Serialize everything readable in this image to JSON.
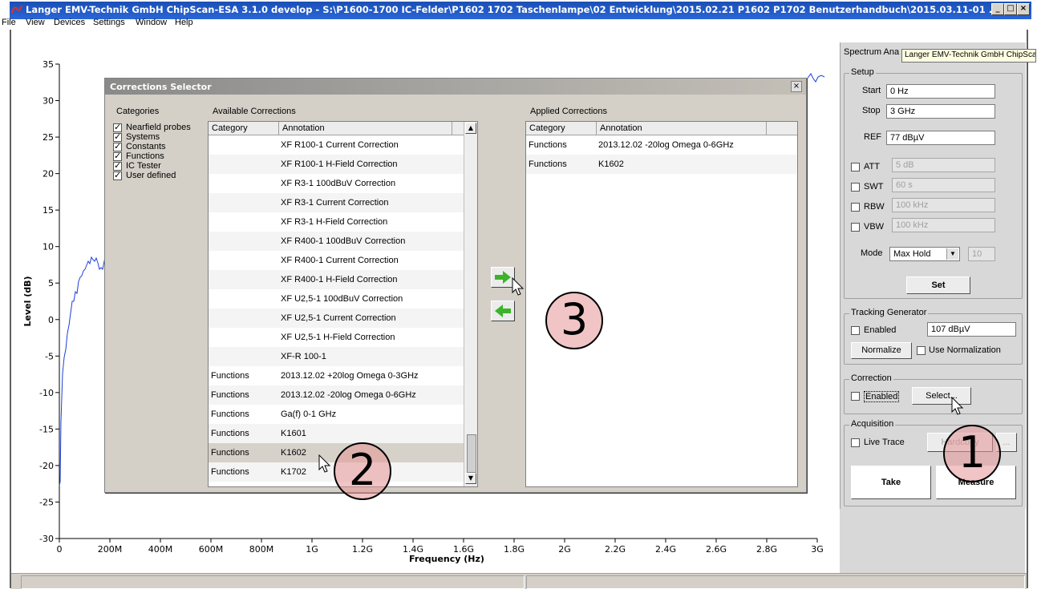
{
  "window": {
    "title": "Langer EMV-Technik GmbH ChipScan-ESA 3.1.0 develop  -  S:\\P1600-1700 IC-Felder\\P1602 1702 Taschenlampe\\02 Entwicklung\\2015.02.21 P1602 P1702 Benutzerhandbuch\\2015.03.11-01 ...",
    "minimize": "_",
    "maximize": "□",
    "close": "×"
  },
  "menu": [
    "File",
    "View",
    "Devices",
    "Settings",
    "Window",
    "Help"
  ],
  "chart": {
    "ylabel": "Level (dB)",
    "xlabel": "Frequency (Hz)",
    "y_ticks": [
      "35",
      "30",
      "25",
      "20",
      "15",
      "10",
      "5",
      "0",
      "-5",
      "-10",
      "-15",
      "-20",
      "-25",
      "-30"
    ],
    "x_ticks": [
      "0",
      "200M",
      "400M",
      "600M",
      "800M",
      "1G",
      "1.2G",
      "1.4G",
      "1.6G",
      "1.8G",
      "2G",
      "2.2G",
      "2.4G",
      "2.6G",
      "2.8G",
      "3G"
    ],
    "trace_color": "#1f3fd8"
  },
  "tooltip": "Langer EMV-Technik GmbH ChipScan-ESA",
  "panel": {
    "title": "Spectrum Ana",
    "setup": {
      "label": "Setup",
      "start_label": "Start",
      "start_value": "0 Hz",
      "stop_label": "Stop",
      "stop_value": "3 GHz",
      "ref_label": "REF",
      "ref_value": "77 dBµV",
      "att_label": "ATT",
      "att_value": "5 dB",
      "swt_label": "SWT",
      "swt_value": "60 s",
      "rbw_label": "RBW",
      "rbw_value": "100 kHz",
      "vbw_label": "VBW",
      "vbw_value": "100 kHz",
      "mode_label": "Mode",
      "mode_value": "Max Hold",
      "mode_count": "10",
      "set_button": "Set"
    },
    "tracking": {
      "label": "Tracking Generator",
      "enabled_label": "Enabled",
      "level_value": "107 dBµV",
      "normalize_button": "Normalize",
      "use_norm_label": "Use Normalization"
    },
    "correction": {
      "label": "Correction",
      "enabled_label": "Enabled",
      "select_button": "Select..."
    },
    "acquisition": {
      "label": "Acquisition",
      "live_trace_label": "Live Trace",
      "hardcopy_button": "Hardcopy",
      "more_button": "...",
      "take_button": "Take",
      "measure_button": "Measure"
    }
  },
  "dialog": {
    "title": "Corrections Selector",
    "close": "×",
    "categories_label": "Categories",
    "categories": [
      {
        "label": "Nearfield probes",
        "checked": true
      },
      {
        "label": "Systems",
        "checked": true
      },
      {
        "label": "Constants",
        "checked": true
      },
      {
        "label": "Functions",
        "checked": true
      },
      {
        "label": "IC Tester",
        "checked": true
      },
      {
        "label": "User defined",
        "checked": true
      }
    ],
    "available_label": "Available Corrections",
    "applied_label": "Applied Corrections",
    "col_category": "Category",
    "col_annotation": "Annotation",
    "available": [
      {
        "category": "",
        "annotation": "XF R100-1 Current Correction"
      },
      {
        "category": "",
        "annotation": "XF R100-1 H-Field Correction"
      },
      {
        "category": "",
        "annotation": "XF R3-1 100dBuV Correction"
      },
      {
        "category": "",
        "annotation": "XF R3-1 Current Correction"
      },
      {
        "category": "",
        "annotation": "XF R3-1 H-Field Correction"
      },
      {
        "category": "",
        "annotation": "XF R400-1 100dBuV Correction"
      },
      {
        "category": "",
        "annotation": "XF R400-1 Current Correction"
      },
      {
        "category": "",
        "annotation": "XF R400-1 H-Field Correction"
      },
      {
        "category": "",
        "annotation": "XF U2,5-1 100dBuV Correction"
      },
      {
        "category": "",
        "annotation": "XF U2,5-1 Current Correction"
      },
      {
        "category": "",
        "annotation": "XF U2,5-1 H-Field Correction"
      },
      {
        "category": "",
        "annotation": "XF-R 100-1"
      },
      {
        "category": "Functions",
        "annotation": "2013.12.02 +20log Omega 0-3GHz"
      },
      {
        "category": "Functions",
        "annotation": "2013.12.02 -20log Omega 0-6GHz"
      },
      {
        "category": "Functions",
        "annotation": "Ga(f) 0-1 GHz"
      },
      {
        "category": "Functions",
        "annotation": "K1601"
      },
      {
        "category": "Functions",
        "annotation": "K1602",
        "selected": true
      },
      {
        "category": "Functions",
        "annotation": "K1702"
      }
    ],
    "applied": [
      {
        "category": "Functions",
        "annotation": "2013.12.02 -20log Omega 0-6GHz"
      },
      {
        "category": "Functions",
        "annotation": "K1602"
      }
    ],
    "add_icon": "arrow-right-icon",
    "remove_icon": "arrow-left-icon"
  },
  "annotations": [
    "1",
    "2",
    "3"
  ]
}
